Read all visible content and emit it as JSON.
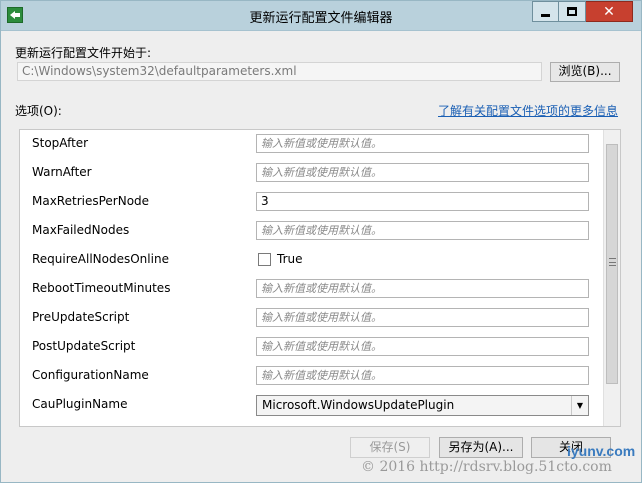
{
  "window": {
    "title": "更新运行配置文件编辑器"
  },
  "start": {
    "label": "更新运行配置文件开始于:",
    "path": "C:\\Windows\\system32\\defaultparameters.xml",
    "browse_label": "浏览(B)..."
  },
  "options": {
    "label": "选项(O):",
    "learn_more": "了解有关配置文件选项的更多信息"
  },
  "placeholder": "输入新值或使用默认值。",
  "rows": [
    {
      "name": "StopAfter",
      "value": ""
    },
    {
      "name": "WarnAfter",
      "value": ""
    },
    {
      "name": "MaxRetriesPerNode",
      "value": "3"
    },
    {
      "name": "MaxFailedNodes",
      "value": ""
    },
    {
      "name": "RequireAllNodesOnline",
      "checkbox_label": "True",
      "checked": false
    },
    {
      "name": "RebootTimeoutMinutes",
      "value": ""
    },
    {
      "name": "PreUpdateScript",
      "value": ""
    },
    {
      "name": "PostUpdateScript",
      "value": ""
    },
    {
      "name": "ConfigurationName",
      "value": ""
    },
    {
      "name": "CauPluginName",
      "selected": "Microsoft.WindowsUpdatePlugin"
    }
  ],
  "buttons": {
    "save": "保存(S)",
    "save_as": "另存为(A)...",
    "close": "关闭"
  },
  "watermark": {
    "text": "© 2016 http://rdsrv.blog.51cto.com",
    "logo": "iyunv.com"
  },
  "icons": {
    "app": "app-icon",
    "minimize": "minimize-icon",
    "maximize": "maximize-icon",
    "close": "close-icon",
    "dropdown": "chevron-down-icon"
  },
  "colors": {
    "titlebar": "#b9d1dc",
    "close_button": "#c7402f",
    "link": "#1a5fb4"
  }
}
